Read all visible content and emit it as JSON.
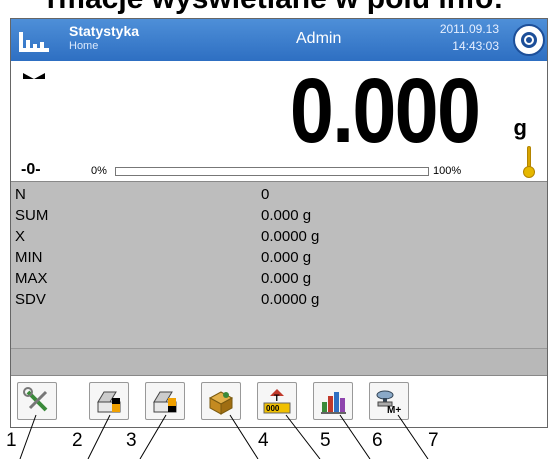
{
  "caption": "rmacje wyświetlane w polu info:",
  "header": {
    "title": "Statystyka",
    "subtitle": "Home",
    "user": "Admin",
    "date": "2011.09.13",
    "time": "14:43:03"
  },
  "weighing": {
    "reading": "0.000",
    "unit": "g",
    "zero_indicator": "-0-",
    "bar_min_label": "0%",
    "bar_max_label": "100%",
    "bar_fill_fraction": 0
  },
  "info": {
    "rows": [
      {
        "label": "N",
        "value": "0"
      },
      {
        "label": "SUM",
        "value": "0.000 g"
      },
      {
        "label": "X",
        "value": "0.0000 g"
      },
      {
        "label": "MIN",
        "value": "0.000 g"
      },
      {
        "label": "MAX",
        "value": "0.000 g"
      },
      {
        "label": "SDV",
        "value": "0.0000 g"
      }
    ]
  },
  "toolbar": {
    "buttons": [
      {
        "icon": "settings-tools-icon"
      },
      {
        "icon": "print-header-icon"
      },
      {
        "icon": "print-footer-icon"
      },
      {
        "icon": "database-box-icon"
      },
      {
        "icon": "tare-icon"
      },
      {
        "icon": "statistics-chart-icon"
      },
      {
        "icon": "add-to-memory-icon"
      }
    ]
  },
  "callouts": [
    "1",
    "2",
    "3",
    "4",
    "5",
    "6",
    "7"
  ],
  "colors": {
    "header_blue": "#2e6fc2",
    "info_gray": "#bdbdbd",
    "thermometer": "#e6b800"
  }
}
